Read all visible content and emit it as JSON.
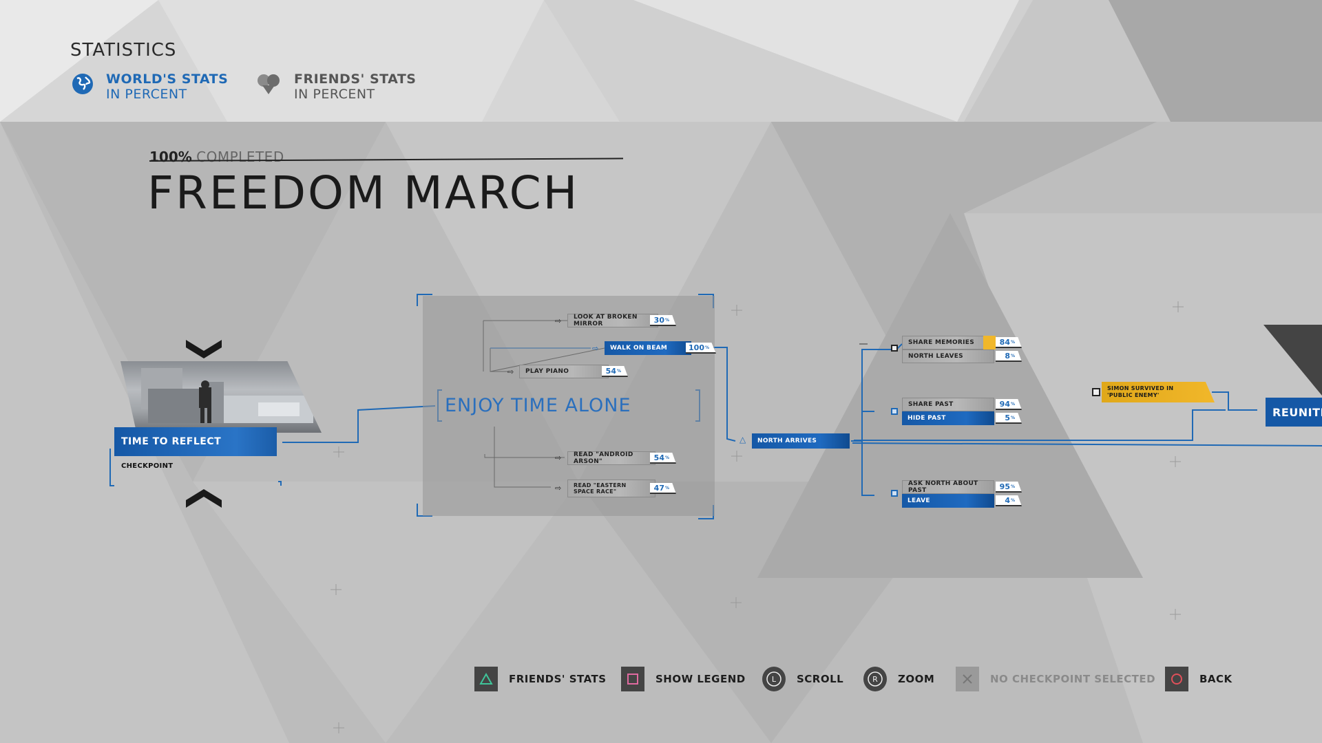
{
  "header": {
    "title": "STATISTICS",
    "tabs": [
      {
        "label": "WORLD'S STATS",
        "sub": "IN PERCENT",
        "icon": "globe-icon",
        "active": true
      },
      {
        "label": "FRIENDS' STATS",
        "sub": "IN PERCENT",
        "icon": "friends-icon",
        "active": false
      }
    ]
  },
  "chapter": {
    "completion_value": "100%",
    "completion_text": "COMPLETED",
    "title": "FREEDOM MARCH"
  },
  "checkpoint": {
    "label": "TIME TO REFLECT",
    "sub": "CHECKPOINT"
  },
  "hub": {
    "title": "ENJOY TIME ALONE",
    "choices": [
      {
        "label": "LOOK AT BROKEN MIRROR",
        "pct": "30"
      },
      {
        "label": "WALK ON BEAM",
        "pct": "100"
      },
      {
        "label": "PLAY PIANO",
        "pct": "54"
      },
      {
        "label": "READ \"ANDROID ARSON\"",
        "pct": "54"
      },
      {
        "label": "READ \"EASTERN SPACE RACE\"",
        "pct": "47"
      }
    ]
  },
  "event": {
    "label": "NORTH ARRIVES"
  },
  "branches": [
    {
      "label": "SHARE MEMORIES",
      "pct": "84"
    },
    {
      "label": "NORTH LEAVES",
      "pct": "8"
    },
    {
      "label": "SHARE PAST",
      "pct": "94"
    },
    {
      "label": "HIDE PAST",
      "pct": "5"
    },
    {
      "label": "ASK NORTH ABOUT PAST",
      "pct": "95"
    },
    {
      "label": "LEAVE",
      "pct": "4"
    }
  ],
  "condition": {
    "label": "SIMON SURVIVED IN 'PUBLIC ENEMY'"
  },
  "next_node": {
    "label": "REUNITE"
  },
  "pct_suffix": "%",
  "controls": [
    {
      "label": "FRIENDS' STATS",
      "icon": "triangle-button-icon",
      "enabled": true
    },
    {
      "label": "SHOW LEGEND",
      "icon": "square-button-icon",
      "enabled": true
    },
    {
      "label": "SCROLL",
      "icon": "left-stick-icon",
      "enabled": true
    },
    {
      "label": "ZOOM",
      "icon": "right-stick-icon",
      "enabled": true
    },
    {
      "label": "NO CHECKPOINT SELECTED",
      "icon": "cross-button-icon",
      "enabled": false
    },
    {
      "label": "BACK",
      "icon": "circle-button-icon",
      "enabled": true
    }
  ],
  "colors": {
    "accent": "#1f69b5",
    "gold": "#f1b72a",
    "triangle": "#3fc59a",
    "square": "#e06aa0",
    "circle": "#e0505a"
  }
}
